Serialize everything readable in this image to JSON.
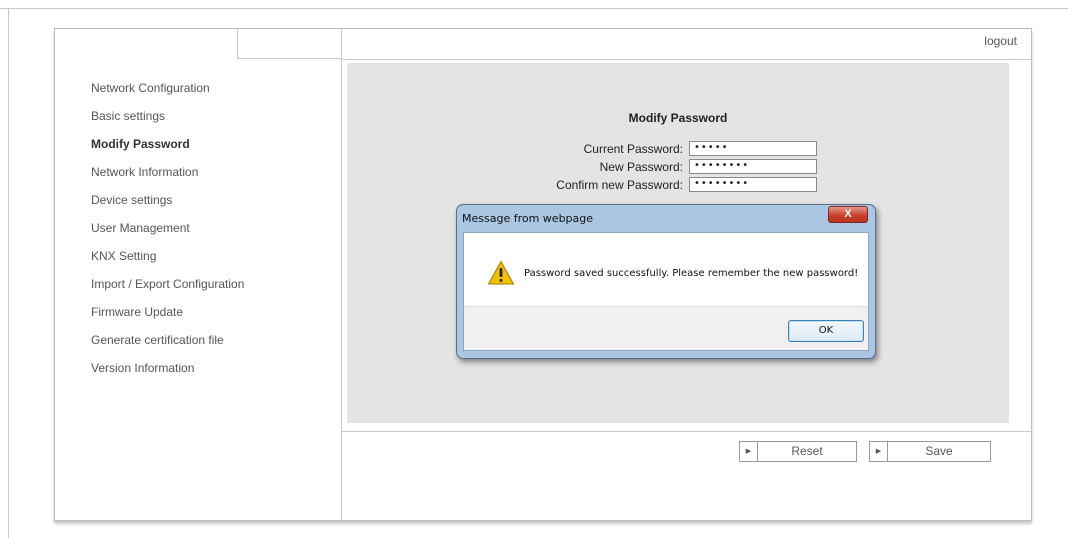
{
  "header": {
    "logout_label": "logout"
  },
  "sidebar": {
    "items": [
      {
        "label": "Network Configuration",
        "active": false
      },
      {
        "label": "Basic settings",
        "active": false
      },
      {
        "label": "Modify Password",
        "active": true
      },
      {
        "label": "Network Information",
        "active": false
      },
      {
        "label": "Device settings",
        "active": false
      },
      {
        "label": "User Management",
        "active": false
      },
      {
        "label": "KNX Setting",
        "active": false
      },
      {
        "label": "Import / Export Configuration",
        "active": false
      },
      {
        "label": "Firmware Update",
        "active": false
      },
      {
        "label": "Generate certification file",
        "active": false
      },
      {
        "label": "Version Information",
        "active": false
      }
    ]
  },
  "form": {
    "title": "Modify Password",
    "current_label": "Current Password:",
    "current_value": "•••••",
    "new_label": "New Password:",
    "new_value": "••••••••",
    "confirm_label": "Confirm new Password:",
    "confirm_value": "••••••••"
  },
  "actions": {
    "reset_label": "Reset",
    "save_label": "Save"
  },
  "dialog": {
    "title": "Message from webpage",
    "close_glyph": "X",
    "message": "Password saved successfully. Please remember the new password!",
    "ok_label": "OK",
    "icon": "warning-icon"
  },
  "icons": {
    "button_arrow": "triangle-right-icon"
  },
  "colors": {
    "panel": "#e4e4e4",
    "dialog_frame": "#a9c6e3",
    "close_button": "#c8412e",
    "warning": "#f2c200"
  }
}
